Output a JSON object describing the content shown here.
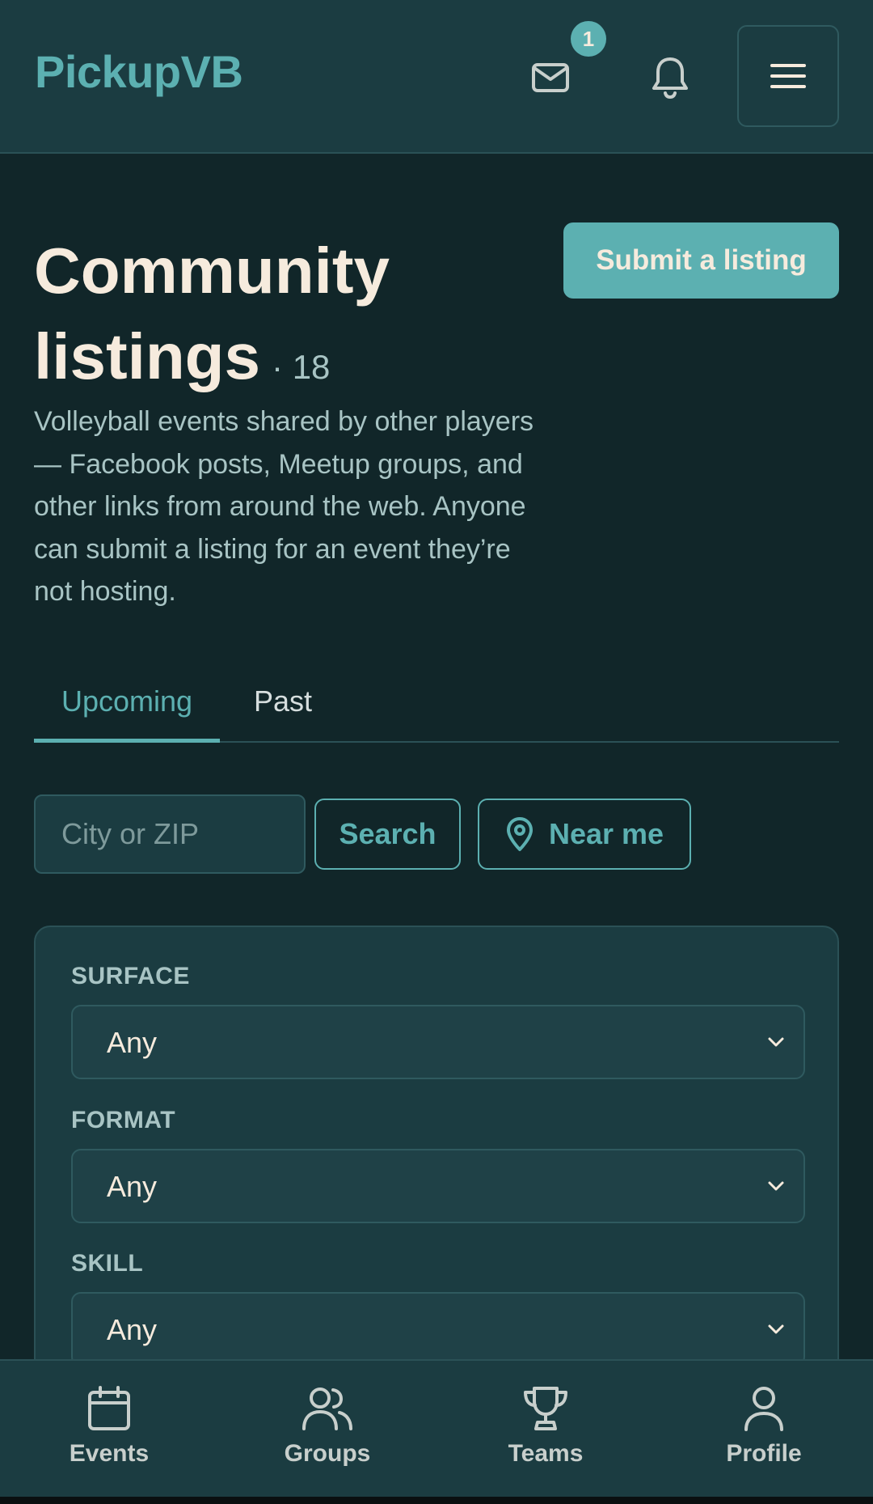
{
  "header": {
    "brand": "PickupVB",
    "messages_badge": "1"
  },
  "page": {
    "title": "Community listings",
    "count": "· 18",
    "submit_label": "Submit a listing",
    "description": "Volleyball events shared by other players — Facebook posts, Meetup groups, and other links from around the web. Anyone can submit a listing for an event they’re not hosting."
  },
  "tabs": [
    {
      "label": "Upcoming",
      "active": true
    },
    {
      "label": "Past",
      "active": false
    }
  ],
  "search": {
    "placeholder": "City or ZIP",
    "search_label": "Search",
    "near_me_label": "Near me"
  },
  "filters": [
    {
      "label": "SURFACE",
      "value": "Any"
    },
    {
      "label": "FORMAT",
      "value": "Any"
    },
    {
      "label": "SKILL",
      "value": "Any"
    }
  ],
  "bottom_nav": [
    {
      "label": "Events",
      "icon": "calendar-icon"
    },
    {
      "label": "Groups",
      "icon": "users-icon"
    },
    {
      "label": "Teams",
      "icon": "trophy-icon"
    },
    {
      "label": "Profile",
      "icon": "user-icon"
    }
  ],
  "colors": {
    "background": "#112629",
    "surface": "#1b3c41",
    "accent": "#5cb0b1",
    "text": "#f6ebdd",
    "muted": "#a8c4c4"
  }
}
